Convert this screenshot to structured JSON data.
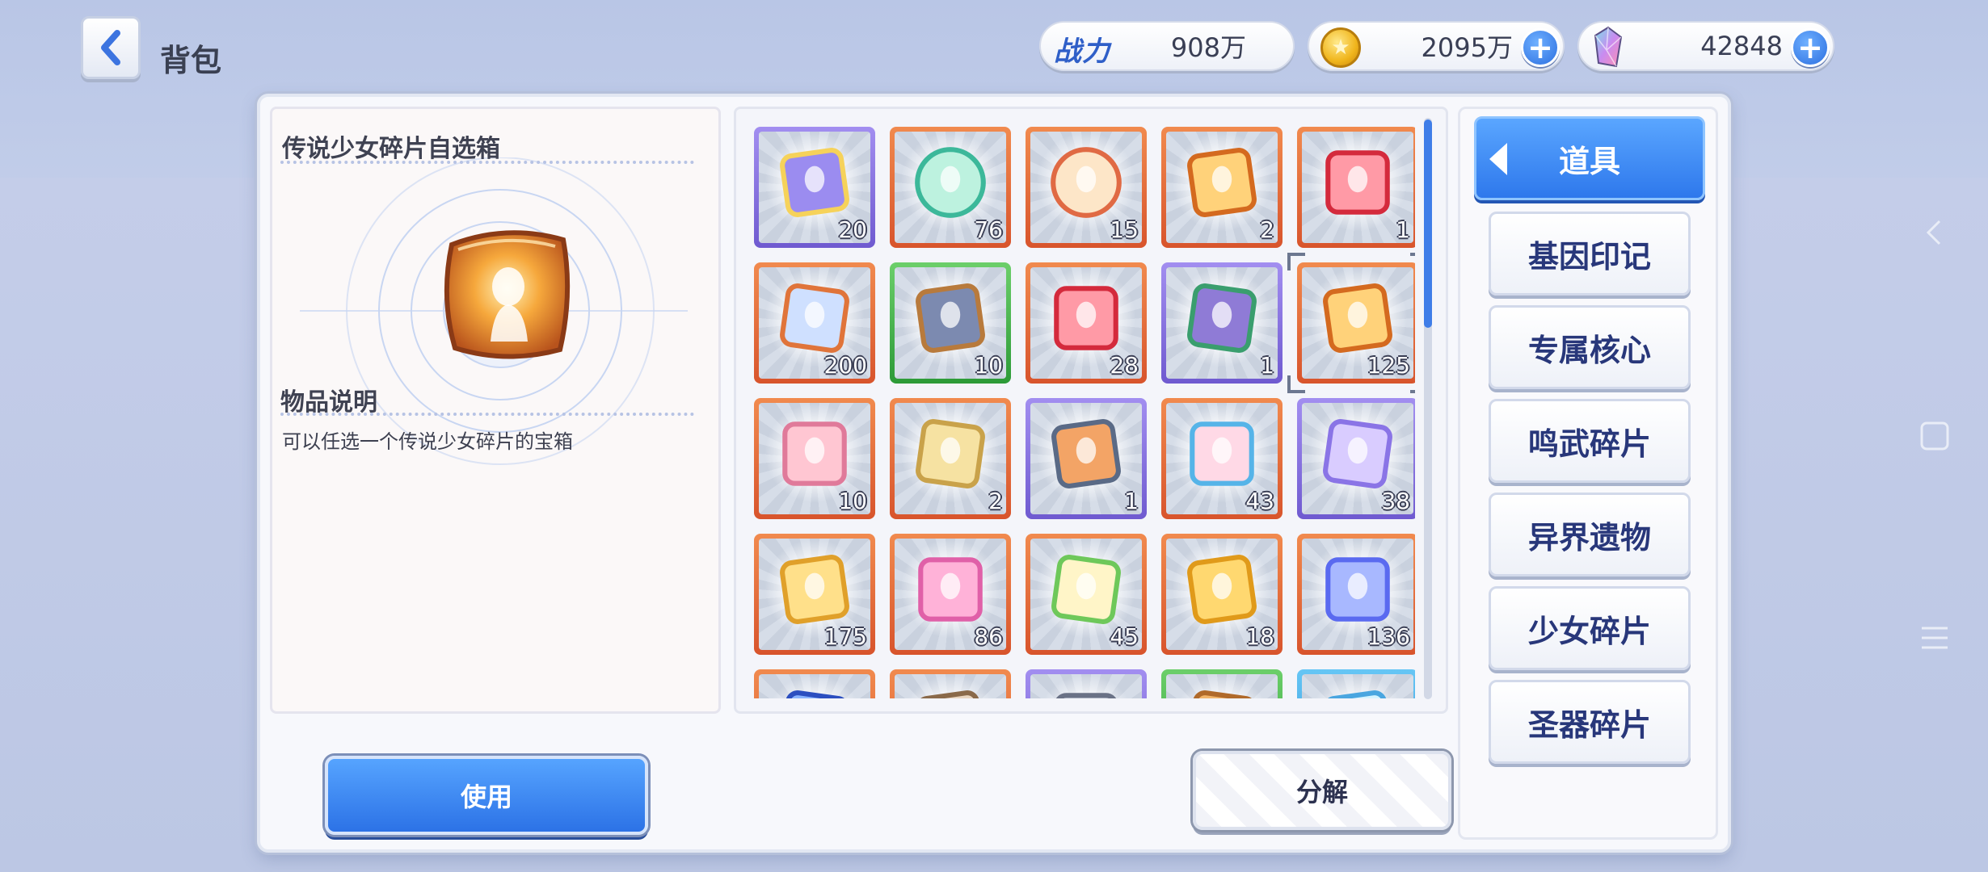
{
  "header": {
    "title": "背包",
    "power": {
      "label": "战力",
      "value": "908万"
    },
    "gold": {
      "icon": "gold-coin-icon",
      "value": "2095万"
    },
    "gem": {
      "icon": "crystal-gem-icon",
      "value": "42848"
    }
  },
  "detail": {
    "item_name": "传说少女碎片自选箱",
    "desc_title": "物品说明",
    "desc_text": "可以任选一个传说少女碎片的宝箱"
  },
  "items": [
    {
      "icon": "purple-can-icon",
      "qty": "20",
      "rarity": "purple"
    },
    {
      "icon": "green-orb-icon",
      "qty": "76",
      "rarity": "orange"
    },
    {
      "icon": "red-orb-icon",
      "qty": "15",
      "rarity": "orange"
    },
    {
      "icon": "gold-cube-icon",
      "qty": "2",
      "rarity": "orange"
    },
    {
      "icon": "red-cube-icon",
      "qty": "1",
      "rarity": "orange"
    },
    {
      "icon": "winged-box-icon",
      "qty": "200",
      "rarity": "orange"
    },
    {
      "icon": "tech-chest-icon",
      "qty": "10",
      "rarity": "green"
    },
    {
      "icon": "red-cube-icon",
      "qty": "28",
      "rarity": "orange"
    },
    {
      "icon": "dna-box-icon",
      "qty": "1",
      "rarity": "purple"
    },
    {
      "icon": "gold-cube-icon",
      "qty": "125",
      "rarity": "orange",
      "selected": true
    },
    {
      "icon": "gift-bag-icon",
      "qty": "10",
      "rarity": "orange"
    },
    {
      "icon": "treasure-box-icon",
      "qty": "2",
      "rarity": "orange"
    },
    {
      "icon": "orange-box-icon",
      "qty": "1",
      "rarity": "purple"
    },
    {
      "icon": "shirt-ticket-icon",
      "qty": "43",
      "rarity": "orange"
    },
    {
      "icon": "smile-ticket-icon",
      "qty": "38",
      "rarity": "purple"
    },
    {
      "icon": "gold-card-icon",
      "qty": "175",
      "rarity": "orange"
    },
    {
      "icon": "dna-card-icon",
      "qty": "86",
      "rarity": "orange"
    },
    {
      "icon": "rainbow-ticket-icon",
      "qty": "45",
      "rarity": "orange"
    },
    {
      "icon": "sword-card-gold-icon",
      "qty": "18",
      "rarity": "orange"
    },
    {
      "icon": "sword-card-blue-icon",
      "qty": "136",
      "rarity": "orange"
    },
    {
      "icon": "blue-crystal-icon",
      "qty": "",
      "rarity": "orange"
    },
    {
      "icon": "bag-icon",
      "qty": "",
      "rarity": "orange"
    },
    {
      "icon": "gray-box-icon",
      "qty": "",
      "rarity": "purple"
    },
    {
      "icon": "cookie-icon",
      "qty": "",
      "rarity": "green"
    },
    {
      "icon": "feather-icon",
      "qty": "",
      "rarity": "blue"
    }
  ],
  "tabs": {
    "active": "道具",
    "items": [
      "基因印记",
      "专属核心",
      "鸣武碎片",
      "异界遗物",
      "少女碎片",
      "圣器碎片"
    ]
  },
  "buttons": {
    "use": "使用",
    "split": "分解"
  },
  "colors": {
    "accent": "#2e78ec",
    "tab_text": "#28377a",
    "rarity_orange": "#e06a34",
    "rarity_purple": "#8a74e6",
    "rarity_green": "#3fae46",
    "rarity_blue": "#3aa4e6"
  }
}
